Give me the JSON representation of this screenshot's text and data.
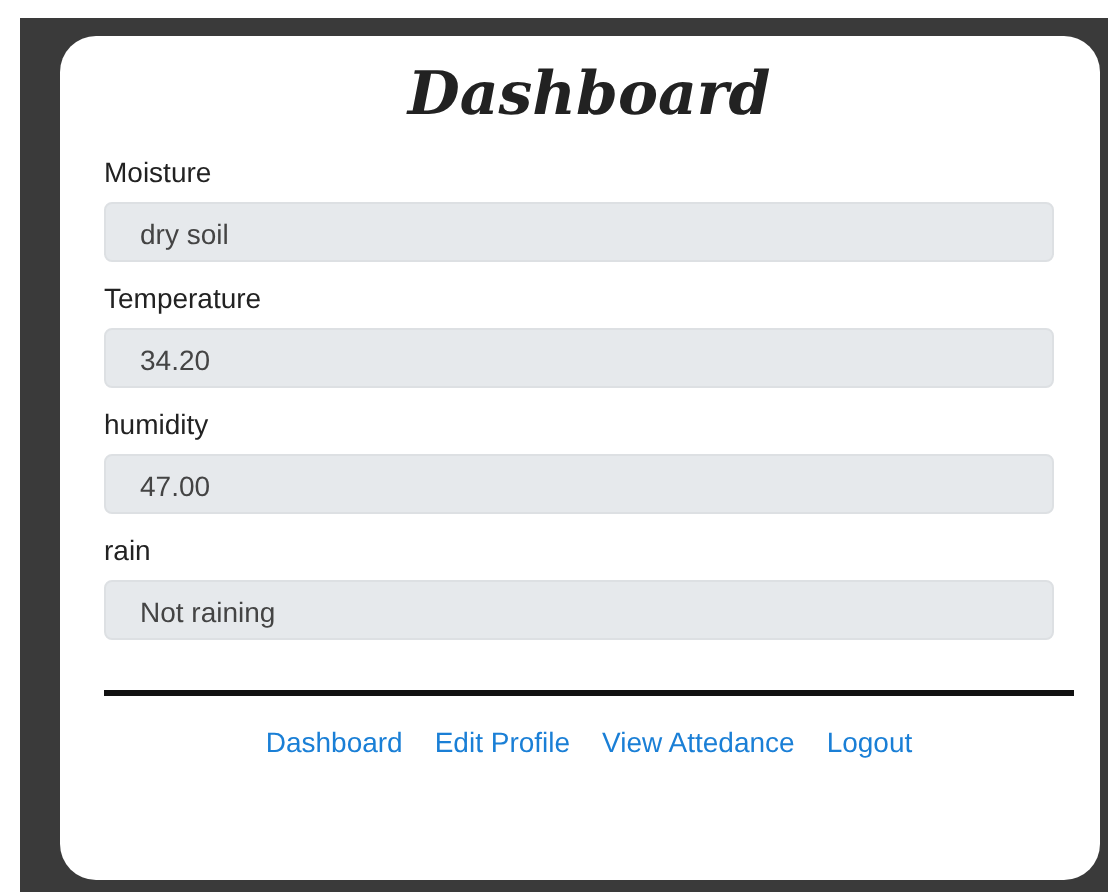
{
  "title": "Dashboard",
  "fields": [
    {
      "label": "Moisture",
      "value": "dry soil"
    },
    {
      "label": "Temperature",
      "value": "34.20"
    },
    {
      "label": "humidity",
      "value": "47.00"
    },
    {
      "label": "rain",
      "value": "Not raining"
    }
  ],
  "nav_links": [
    "Dashboard",
    "Edit Profile",
    "View Attedance",
    "Logout"
  ]
}
